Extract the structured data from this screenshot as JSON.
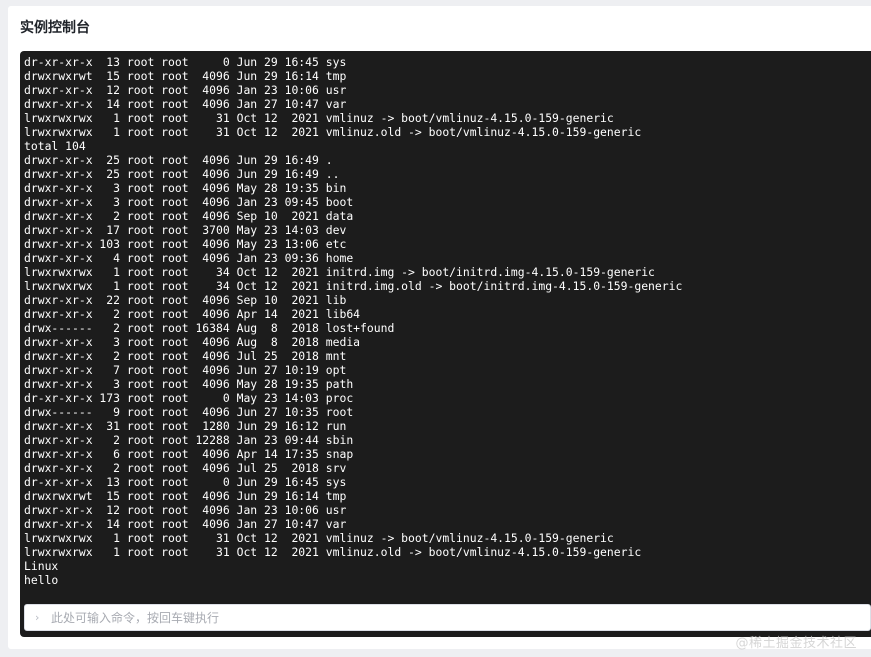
{
  "panel": {
    "title": "实例控制台"
  },
  "terminal": {
    "lines": [
      "dr-xr-xr-x  13 root root     0 Jun 29 16:45 sys",
      "drwxrwxrwt  15 root root  4096 Jun 29 16:14 tmp",
      "drwxr-xr-x  12 root root  4096 Jan 23 10:06 usr",
      "drwxr-xr-x  14 root root  4096 Jan 27 10:47 var",
      "lrwxrwxrwx   1 root root    31 Oct 12  2021 vmlinuz -> boot/vmlinuz-4.15.0-159-generic",
      "lrwxrwxrwx   1 root root    31 Oct 12  2021 vmlinuz.old -> boot/vmlinuz-4.15.0-159-generic",
      "total 104",
      "drwxr-xr-x  25 root root  4096 Jun 29 16:49 .",
      "drwxr-xr-x  25 root root  4096 Jun 29 16:49 ..",
      "drwxr-xr-x   3 root root  4096 May 28 19:35 bin",
      "drwxr-xr-x   3 root root  4096 Jan 23 09:45 boot",
      "drwxr-xr-x   2 root root  4096 Sep 10  2021 data",
      "drwxr-xr-x  17 root root  3700 May 23 14:03 dev",
      "drwxr-xr-x 103 root root  4096 May 23 13:06 etc",
      "drwxr-xr-x   4 root root  4096 Jan 23 09:36 home",
      "lrwxrwxrwx   1 root root    34 Oct 12  2021 initrd.img -> boot/initrd.img-4.15.0-159-generic",
      "lrwxrwxrwx   1 root root    34 Oct 12  2021 initrd.img.old -> boot/initrd.img-4.15.0-159-generic",
      "drwxr-xr-x  22 root root  4096 Sep 10  2021 lib",
      "drwxr-xr-x   2 root root  4096 Apr 14  2021 lib64",
      "drwx------   2 root root 16384 Aug  8  2018 lost+found",
      "drwxr-xr-x   3 root root  4096 Aug  8  2018 media",
      "drwxr-xr-x   2 root root  4096 Jul 25  2018 mnt",
      "drwxr-xr-x   7 root root  4096 Jun 27 10:19 opt",
      "drwxr-xr-x   3 root root  4096 May 28 19:35 path",
      "dr-xr-xr-x 173 root root     0 May 23 14:03 proc",
      "drwx------   9 root root  4096 Jun 27 10:35 root",
      "drwxr-xr-x  31 root root  1280 Jun 29 16:12 run",
      "drwxr-xr-x   2 root root 12288 Jan 23 09:44 sbin",
      "drwxr-xr-x   6 root root  4096 Apr 14 17:35 snap",
      "drwxr-xr-x   2 root root  4096 Jul 25  2018 srv",
      "dr-xr-xr-x  13 root root     0 Jun 29 16:45 sys",
      "drwxrwxrwt  15 root root  4096 Jun 29 16:14 tmp",
      "drwxr-xr-x  12 root root  4096 Jan 23 10:06 usr",
      "drwxr-xr-x  14 root root  4096 Jan 27 10:47 var",
      "lrwxrwxrwx   1 root root    31 Oct 12  2021 vmlinuz -> boot/vmlinuz-4.15.0-159-generic",
      "lrwxrwxrwx   1 root root    31 Oct 12  2021 vmlinuz.old -> boot/vmlinuz-4.15.0-159-generic",
      "Linux",
      "hello"
    ]
  },
  "command_input": {
    "prompt_icon": "chevron-right-icon",
    "placeholder": "此处可输入命令，按回车键执行",
    "value": ""
  },
  "watermark": {
    "text": "@稀土掘金技术社区"
  },
  "colors": {
    "page_bg": "#eeeff2",
    "card_bg": "#ffffff",
    "terminal_bg": "#1c1c1c",
    "terminal_fg": "#ffffff"
  }
}
